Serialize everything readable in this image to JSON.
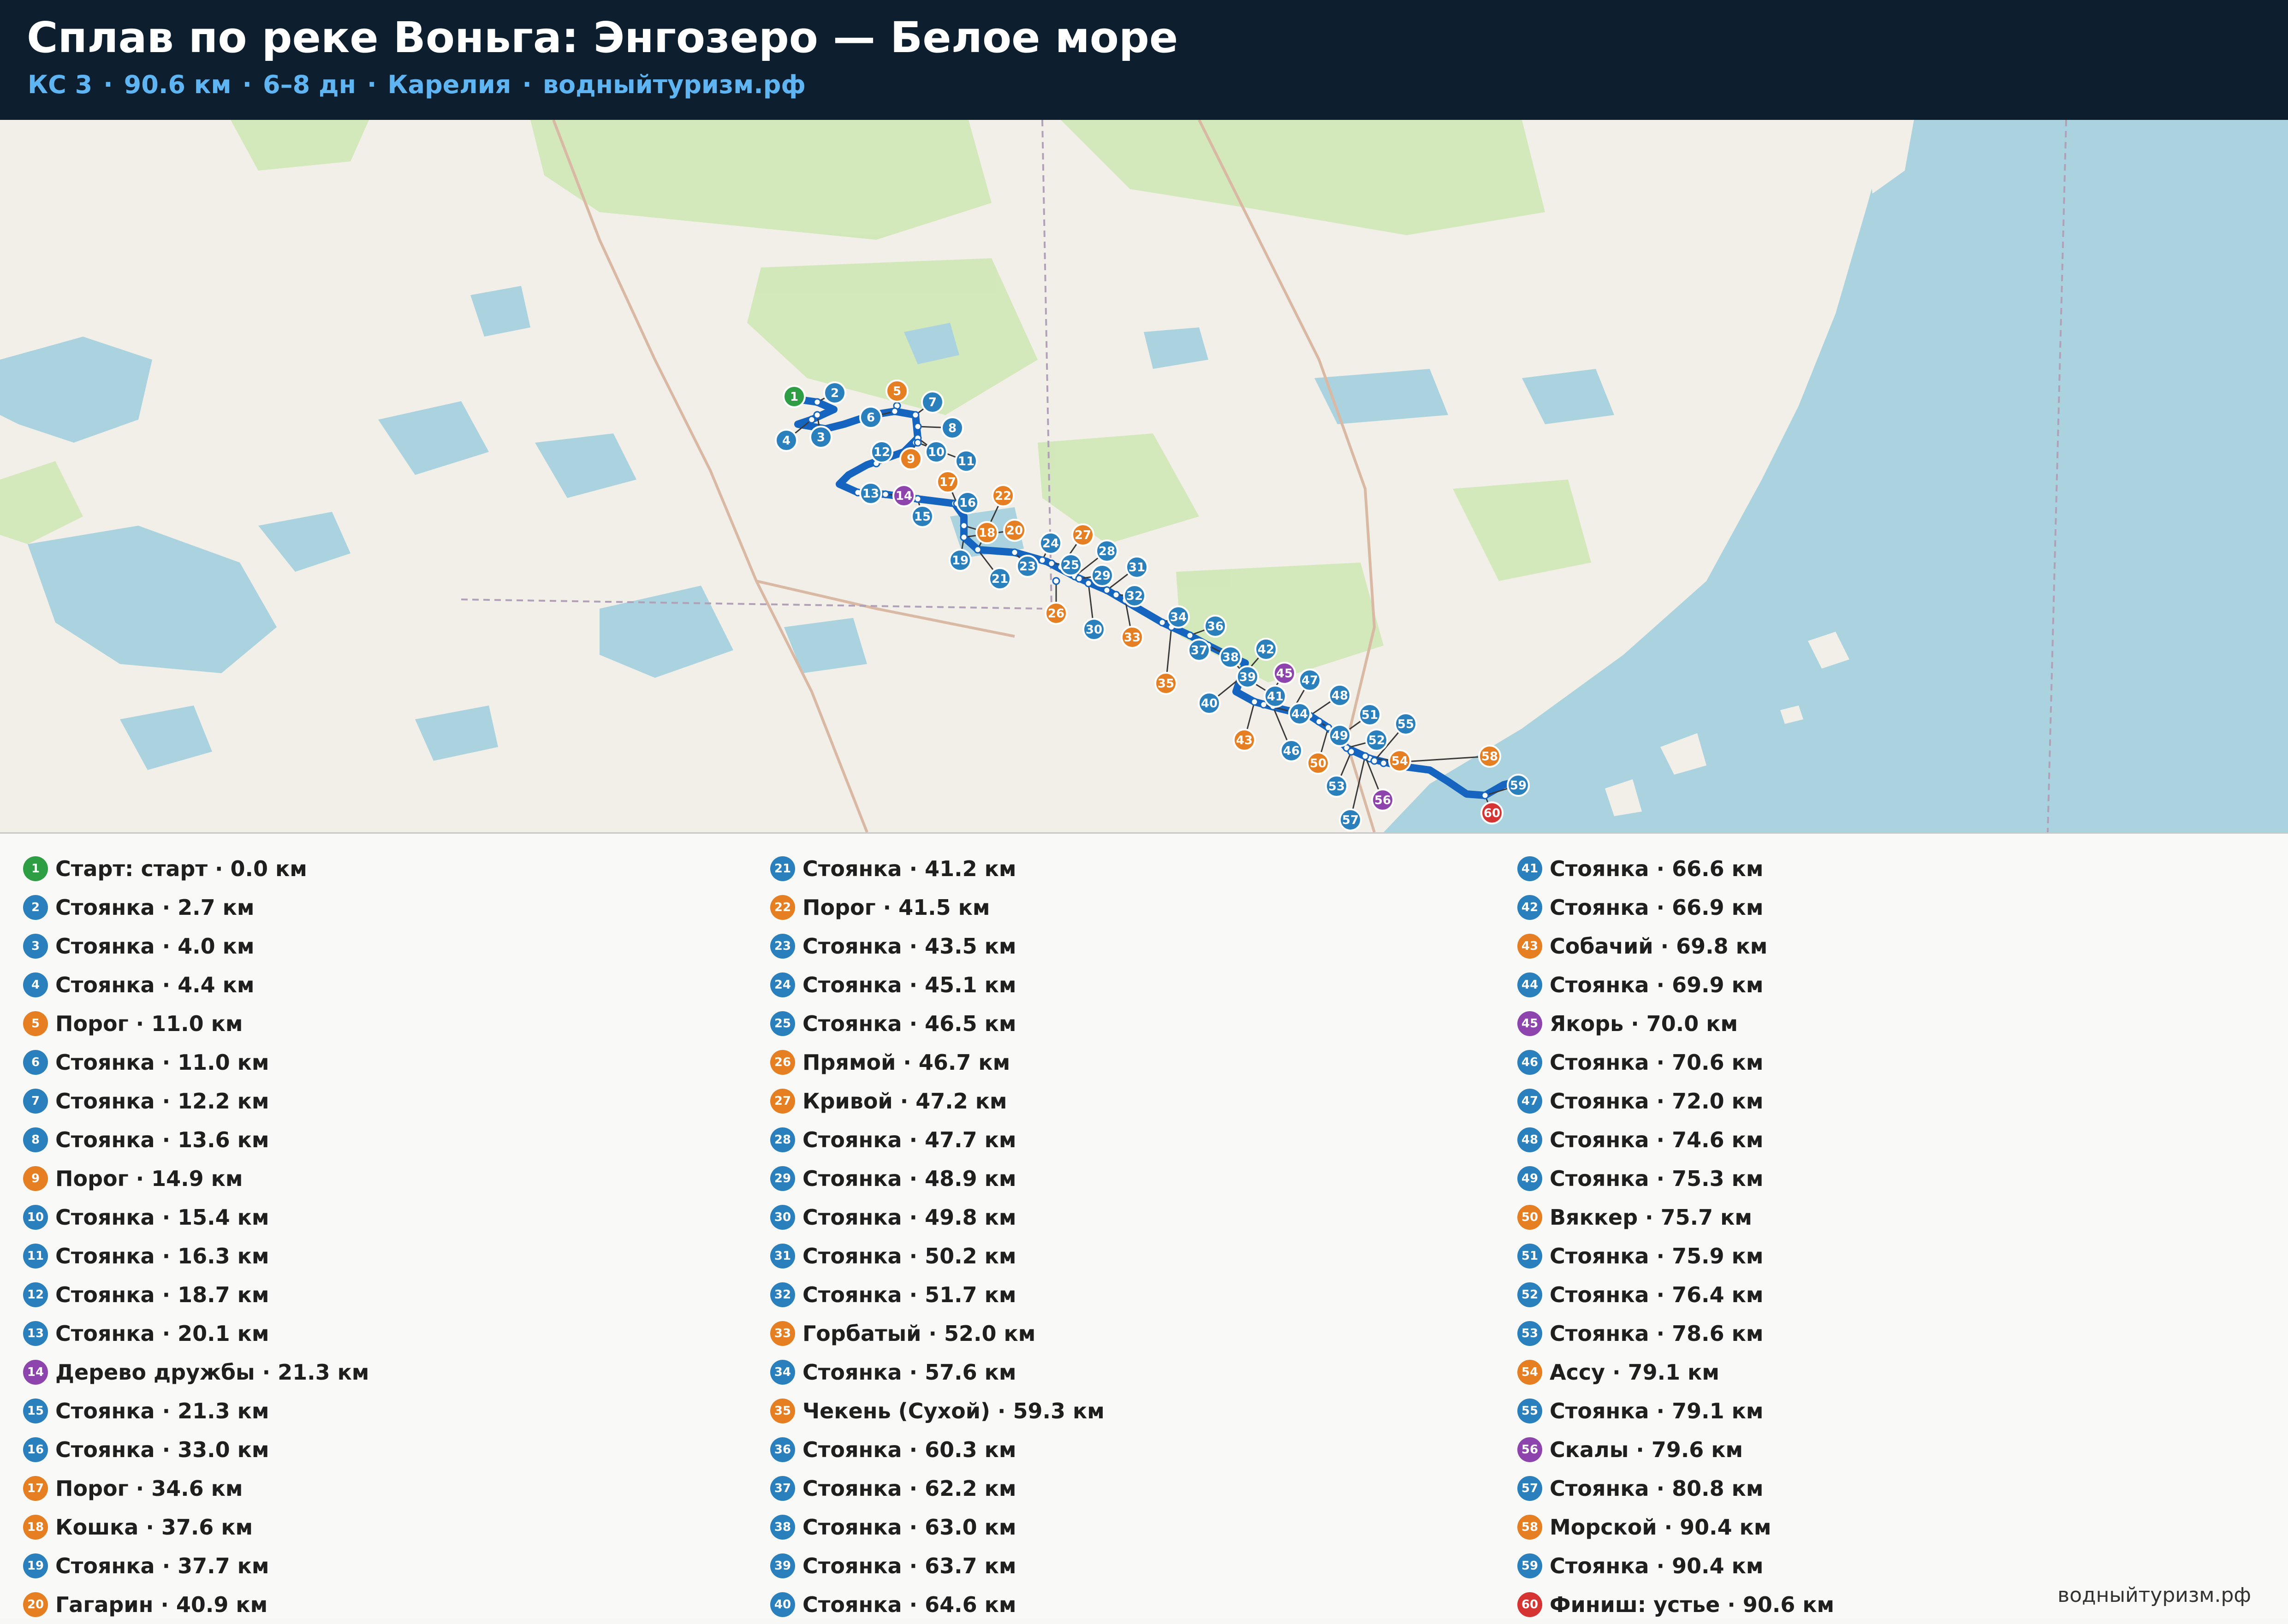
{
  "title": "Сплав по реке Воньга: Энгозеро — Белое море",
  "subtitle": {
    "difficulty": "КС 3",
    "distance": "90.6 км",
    "duration": "6–8 дн",
    "region": "Карелия",
    "site": "водныйтуризм.рф",
    "separator": "·"
  },
  "footer": "водныйтуризм.рф",
  "colors": {
    "header_bg": "#0d1f2f",
    "subtitle": "#5fb4f2",
    "route": "#1565c0",
    "camp": "#2a7fbd",
    "rapid": "#e67e22",
    "poi": "#8e44ad",
    "start": "#2e9e44",
    "finish": "#d63333",
    "water": "#aad3df",
    "land": "#f2efe9",
    "forest": "#c8e6ab"
  },
  "map": {
    "type": "route-map",
    "icons": {
      "camp": "camp-marker-icon",
      "rapid": "rapid-marker-icon",
      "poi": "poi-marker-icon",
      "start": "start-marker-icon",
      "finish": "finish-marker-icon"
    }
  },
  "points": [
    {
      "n": "1",
      "label": "Старт: старт · 0.0 км",
      "kind": "start"
    },
    {
      "n": "2",
      "label": "Стоянка · 2.7 км",
      "kind": "camp"
    },
    {
      "n": "3",
      "label": "Стоянка · 4.0 км",
      "kind": "camp"
    },
    {
      "n": "4",
      "label": "Стоянка · 4.4 км",
      "kind": "camp"
    },
    {
      "n": "5",
      "label": "Порог · 11.0 км",
      "kind": "rapid"
    },
    {
      "n": "6",
      "label": "Стоянка · 11.0 км",
      "kind": "camp"
    },
    {
      "n": "7",
      "label": "Стоянка · 12.2 км",
      "kind": "camp"
    },
    {
      "n": "8",
      "label": "Стоянка · 13.6 км",
      "kind": "camp"
    },
    {
      "n": "9",
      "label": "Порог · 14.9 км",
      "kind": "rapid"
    },
    {
      "n": "10",
      "label": "Стоянка · 15.4 км",
      "kind": "camp"
    },
    {
      "n": "11",
      "label": "Стоянка · 16.3 км",
      "kind": "camp"
    },
    {
      "n": "12",
      "label": "Стоянка · 18.7 км",
      "kind": "camp"
    },
    {
      "n": "13",
      "label": "Стоянка · 20.1 км",
      "kind": "camp"
    },
    {
      "n": "14",
      "label": "Дерево дружбы · 21.3 км",
      "kind": "poi"
    },
    {
      "n": "15",
      "label": "Стоянка · 21.3 км",
      "kind": "camp"
    },
    {
      "n": "16",
      "label": "Стоянка · 33.0 км",
      "kind": "camp"
    },
    {
      "n": "17",
      "label": "Порог · 34.6 км",
      "kind": "rapid"
    },
    {
      "n": "18",
      "label": "Кошка · 37.6 км",
      "kind": "rapid"
    },
    {
      "n": "19",
      "label": "Стоянка · 37.7 км",
      "kind": "camp"
    },
    {
      "n": "20",
      "label": "Гагарин · 40.9 км",
      "kind": "rapid"
    },
    {
      "n": "21",
      "label": "Стоянка · 41.2 км",
      "kind": "camp"
    },
    {
      "n": "22",
      "label": "Порог · 41.5 км",
      "kind": "rapid"
    },
    {
      "n": "23",
      "label": "Стоянка · 43.5 км",
      "kind": "camp"
    },
    {
      "n": "24",
      "label": "Стоянка · 45.1 км",
      "kind": "camp"
    },
    {
      "n": "25",
      "label": "Стоянка · 46.5 км",
      "kind": "camp"
    },
    {
      "n": "26",
      "label": "Прямой · 46.7 км",
      "kind": "rapid"
    },
    {
      "n": "27",
      "label": "Кривой · 47.2 км",
      "kind": "rapid"
    },
    {
      "n": "28",
      "label": "Стоянка · 47.7 км",
      "kind": "camp"
    },
    {
      "n": "29",
      "label": "Стоянка · 48.9 км",
      "kind": "camp"
    },
    {
      "n": "30",
      "label": "Стоянка · 49.8 км",
      "kind": "camp"
    },
    {
      "n": "31",
      "label": "Стоянка · 50.2 км",
      "kind": "camp"
    },
    {
      "n": "32",
      "label": "Стоянка · 51.7 км",
      "kind": "camp"
    },
    {
      "n": "33",
      "label": "Горбатый · 52.0 км",
      "kind": "rapid"
    },
    {
      "n": "34",
      "label": "Стоянка · 57.6 км",
      "kind": "camp"
    },
    {
      "n": "35",
      "label": "Чекень (Сухой) · 59.3 км",
      "kind": "rapid"
    },
    {
      "n": "36",
      "label": "Стоянка · 60.3 км",
      "kind": "camp"
    },
    {
      "n": "37",
      "label": "Стоянка · 62.2 км",
      "kind": "camp"
    },
    {
      "n": "38",
      "label": "Стоянка · 63.0 км",
      "kind": "camp"
    },
    {
      "n": "39",
      "label": "Стоянка · 63.7 км",
      "kind": "camp"
    },
    {
      "n": "40",
      "label": "Стоянка · 64.6 км",
      "kind": "camp"
    },
    {
      "n": "41",
      "label": "Стоянка · 66.6 км",
      "kind": "camp"
    },
    {
      "n": "42",
      "label": "Стоянка · 66.9 км",
      "kind": "camp"
    },
    {
      "n": "43",
      "label": "Собачий · 69.8 км",
      "kind": "rapid"
    },
    {
      "n": "44",
      "label": "Стоянка · 69.9 км",
      "kind": "camp"
    },
    {
      "n": "45",
      "label": "Якорь · 70.0 км",
      "kind": "poi"
    },
    {
      "n": "46",
      "label": "Стоянка · 70.6 км",
      "kind": "camp"
    },
    {
      "n": "47",
      "label": "Стоянка · 72.0 км",
      "kind": "camp"
    },
    {
      "n": "48",
      "label": "Стоянка · 74.6 км",
      "kind": "camp"
    },
    {
      "n": "49",
      "label": "Стоянка · 75.3 км",
      "kind": "camp"
    },
    {
      "n": "50",
      "label": "Вяккер · 75.7 км",
      "kind": "rapid"
    },
    {
      "n": "51",
      "label": "Стоянка · 75.9 км",
      "kind": "camp"
    },
    {
      "n": "52",
      "label": "Стоянка · 76.4 км",
      "kind": "camp"
    },
    {
      "n": "53",
      "label": "Стоянка · 78.6 км",
      "kind": "camp"
    },
    {
      "n": "54",
      "label": "Ассу · 79.1 км",
      "kind": "rapid"
    },
    {
      "n": "55",
      "label": "Стоянка · 79.1 км",
      "kind": "camp"
    },
    {
      "n": "56",
      "label": "Скалы · 79.6 км",
      "kind": "poi"
    },
    {
      "n": "57",
      "label": "Стоянка · 80.8 км",
      "kind": "camp"
    },
    {
      "n": "58",
      "label": "Морской · 90.4 км",
      "kind": "rapid"
    },
    {
      "n": "59",
      "label": "Стоянка · 90.4 км",
      "kind": "camp"
    },
    {
      "n": "60",
      "label": "Финиш: устье · 90.6 км",
      "kind": "finish"
    }
  ]
}
